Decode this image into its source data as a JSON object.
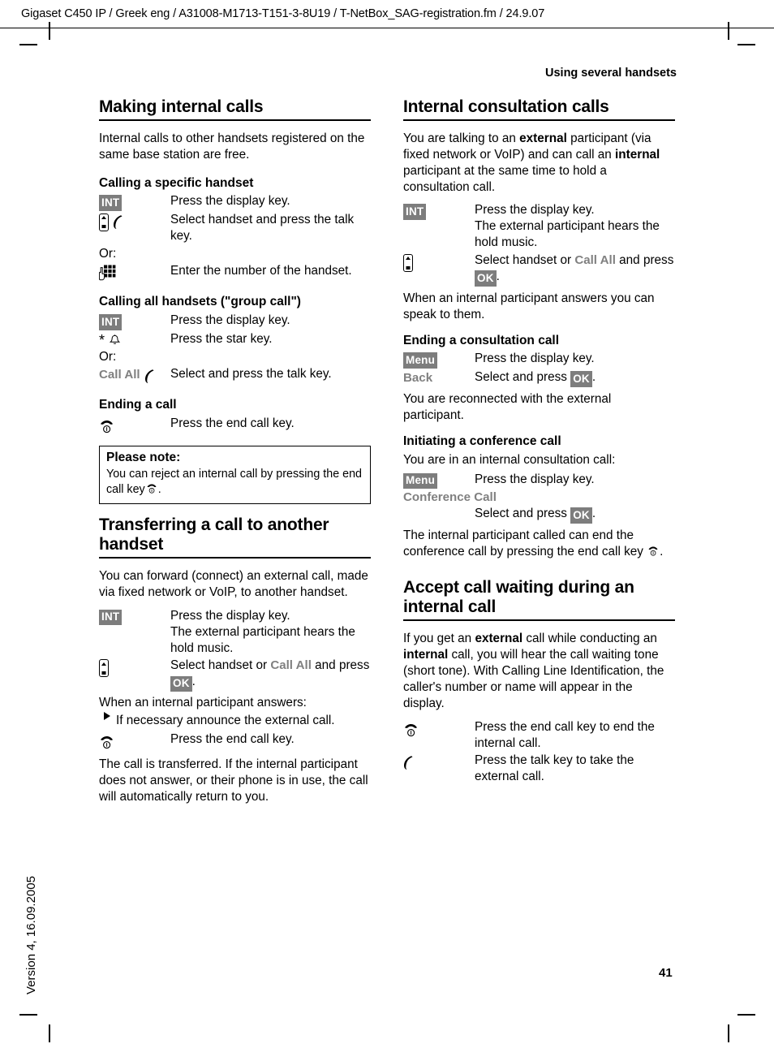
{
  "header": {
    "slug": "Gigaset C450 IP / Greek eng / A31008-M1713-T151-3-8U19 / T-NetBox_SAG-registration.fm / 24.9.07",
    "running_head": "Using several handsets"
  },
  "footer": {
    "page_number": "41",
    "side_version": "Version 4, 16.09.2005"
  },
  "left_column": {
    "section_title": "Making internal calls",
    "intro": "Internal calls to other handsets registered on the same base station are free.",
    "sub1": {
      "title": "Calling a specific handset",
      "row1_key": "INT",
      "row1_desc": "Press the display key.",
      "row2_desc": "Select handset and press the talk key.",
      "or": "Or:",
      "row3_desc": "Enter the number of the handset."
    },
    "sub2": {
      "title": "Calling all handsets (\"group call\")",
      "row1_key": "INT",
      "row1_desc": "Press the display key.",
      "row2_desc": "Press the star key.",
      "or": "Or:",
      "row3_key": "Call All",
      "row3_desc": "Select and press the talk key."
    },
    "sub3": {
      "title": "Ending a call",
      "row1_desc": "Press the end call key."
    },
    "note": {
      "title": "Please note:",
      "body_before": "You can reject an internal call by pressing the end call key",
      "body_after": "."
    },
    "section2_title": "Transferring a call to another handset",
    "section2_intro": "You can forward (connect) an external call, made via fixed network or VoIP, to another handset.",
    "transfer": {
      "row1_key": "INT",
      "row1_desc_l1": "Press the display key.",
      "row1_desc_l2": "The external participant hears the hold music.",
      "row2_desc_before": "Select handset or",
      "row2_softkey": "Call All",
      "row2_desc_mid": "and press",
      "row2_okkey": "OK",
      "row2_desc_after": ".",
      "answers_line": "When an internal participant answers:",
      "bullet": "If necessary announce the external call.",
      "row3_desc": "Press the end call key.",
      "closing": "The call is transferred. If the internal participant does not answer, or their phone is in use, the call will automatically return to you."
    }
  },
  "right_column": {
    "section_title": "Internal consultation calls",
    "intro_p1": "You are talking to an ",
    "intro_em1": "external",
    "intro_p2": " participant (via fixed network or VoIP) and can call an ",
    "intro_em2": "internal",
    "intro_p3": " participant at the same time to hold a consultation call.",
    "consult": {
      "row1_key": "INT",
      "row1_desc_l1": "Press the display key.",
      "row1_desc_l2": "The external participant hears the hold music.",
      "row2_desc_before": "Select handset or",
      "row2_softkey": "Call All",
      "row2_desc_mid": "and press",
      "row2_okkey": "OK",
      "row2_desc_after": ".",
      "after": "When an internal participant answers you can speak to them."
    },
    "sub_ending": {
      "title": "Ending a consultation call",
      "row1_key": "Menu",
      "row1_desc": "Press the display key.",
      "row2_key": "Back",
      "row2_desc_before": "Select and press",
      "row2_okkey": "OK",
      "row2_desc_after": ".",
      "after": "You are reconnected with the external participant."
    },
    "sub_conference": {
      "title": "Initiating a conference call",
      "intro": "You are in an internal consultation call:",
      "row1_key": "Menu",
      "row1_desc": "Press the display key.",
      "row2_key": "Conference Call",
      "row2_desc_before": "Select and press",
      "row2_okkey": "OK",
      "row2_desc_after": ".",
      "after_before": "The internal participant called can end the conference call by pressing the end call key",
      "after_after": "."
    },
    "section2_title": "Accept call waiting during an internal call",
    "accept": {
      "intro_p1": "If you get an ",
      "intro_em1": "external",
      "intro_p2": " call while conducting an ",
      "intro_em2": "internal",
      "intro_p3": " call, you will hear the call waiting tone (short tone). With Calling Line Identification, the caller's number or name will appear in the display.",
      "row1_desc": "Press the end call key to end the internal call.",
      "row2_desc": "Press the talk key to take the external call."
    }
  },
  "colors": {
    "display_key_bg": "#7d7d7d",
    "soft_key_text": "#808080",
    "text": "#000000"
  },
  "icons": {
    "handset": "handset-icon",
    "talk": "talk-key-icon",
    "end_call": "end-call-key-icon",
    "keypad": "keypad-icon",
    "star": "star-key-icon",
    "bell": "bell-icon",
    "bullet": "bullet-triangle-icon"
  }
}
